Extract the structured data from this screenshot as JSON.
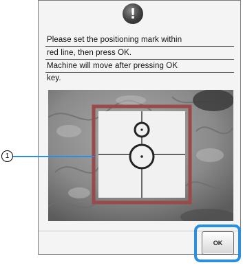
{
  "dialog": {
    "icon": "exclamation-icon",
    "icon_glyph": "!",
    "message_lines": [
      "Please set the positioning mark within",
      "red line, then press OK.",
      "Machine will move after pressing OK",
      "key."
    ],
    "ok_label": "OK"
  },
  "callout": {
    "number": "1"
  },
  "colors": {
    "highlight": "#2b8fe0",
    "frame_red": "#9a4a4a"
  }
}
